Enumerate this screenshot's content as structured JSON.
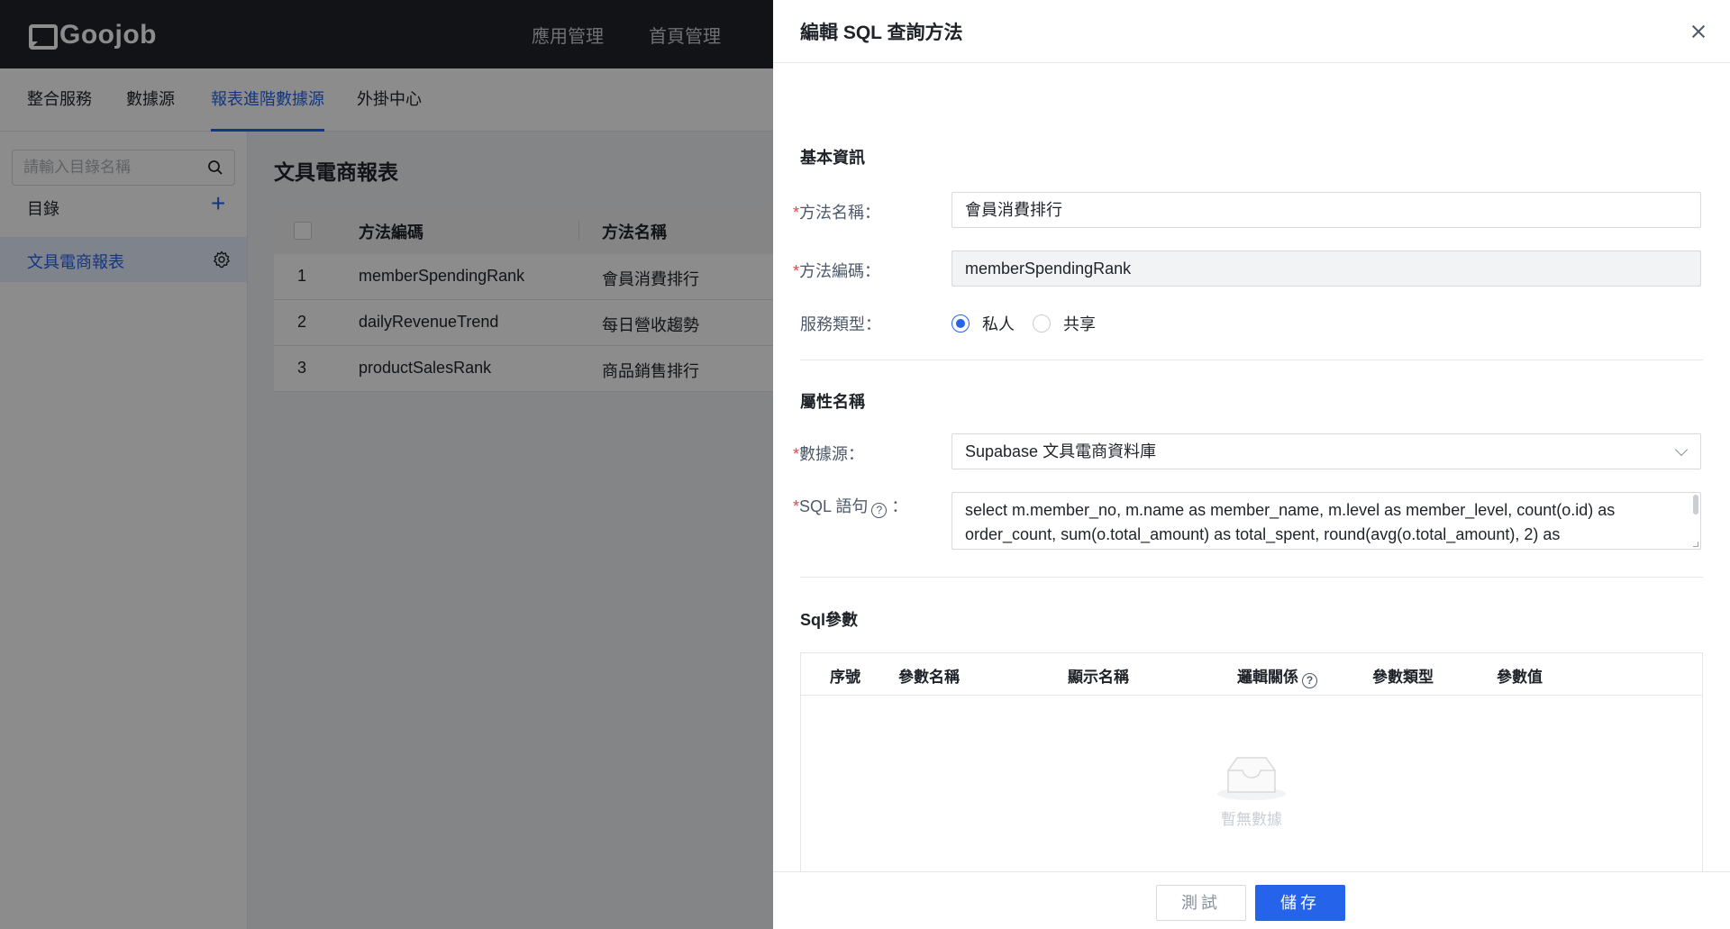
{
  "app": {
    "logo_text": "Goojob"
  },
  "top_nav": [
    "應用管理",
    "首頁管理"
  ],
  "sub_nav": [
    {
      "label": "整合服務",
      "active": false
    },
    {
      "label": "數據源",
      "active": false
    },
    {
      "label": "報表進階數據源",
      "active": true
    },
    {
      "label": "外掛中心",
      "active": false
    }
  ],
  "sidebar": {
    "search_placeholder": "請輸入目錄名稱",
    "directory_label": "目錄",
    "add_symbol": "+",
    "items": [
      {
        "label": "文具電商報表",
        "active": true
      }
    ]
  },
  "main": {
    "title": "文具電商報表",
    "columns": [
      "方法編碼",
      "方法名稱"
    ],
    "rows": [
      {
        "index": "1",
        "code": "memberSpendingRank",
        "name": "會員消費排行"
      },
      {
        "index": "2",
        "code": "dailyRevenueTrend",
        "name": "每日營收趨勢"
      },
      {
        "index": "3",
        "code": "productSalesRank",
        "name": "商品銷售排行"
      }
    ]
  },
  "drawer": {
    "title": "編輯 SQL 查詢方法",
    "basic_section": "基本資訊",
    "method_name_label": "方法名稱：",
    "method_name_value": "會員消費排行",
    "method_code_label": "方法編碼：",
    "method_code_value": "memberSpendingRank",
    "service_type_label": "服務類型：",
    "service_options": [
      {
        "label": "私人",
        "checked": true
      },
      {
        "label": "共享",
        "checked": false
      }
    ],
    "attr_section": "屬性名稱",
    "datasource_label": "數據源：",
    "datasource_value": "Supabase 文具電商資料庫",
    "sql_label": "SQL 語句",
    "sql_colon": "：",
    "sql_value": "select m.member_no, m.name as member_name, m.level as member_level, count(o.id) as order_count, sum(o.total_amount) as total_spent, round(avg(o.total_amount), 2) as",
    "params_section": "Sql參數",
    "param_columns": [
      "序號",
      "參數名稱",
      "顯示名稱",
      "邏輯關係",
      "參數類型",
      "參數值"
    ],
    "empty_text": "暫無數據",
    "test_button": "測試",
    "save_button": "儲存",
    "required_mark": "*",
    "help_mark": "?"
  },
  "colors": {
    "primary": "#2563eb",
    "required": "#e54545",
    "topbar": "#1f2329"
  }
}
